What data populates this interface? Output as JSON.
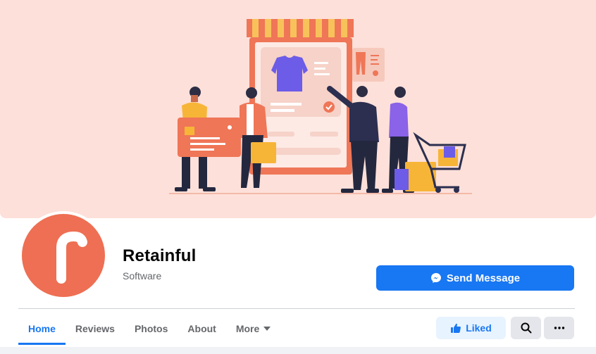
{
  "page": {
    "name": "Retainful",
    "category": "Software",
    "avatar_letter": "r"
  },
  "actions": {
    "send_message": "Send Message",
    "liked": "Liked"
  },
  "tabs": [
    {
      "label": "Home",
      "active": true
    },
    {
      "label": "Reviews",
      "active": false
    },
    {
      "label": "Photos",
      "active": false
    },
    {
      "label": "About",
      "active": false
    },
    {
      "label": "More",
      "active": false
    }
  ],
  "icons": {
    "messenger": "messenger-icon",
    "like": "thumbs-up-icon",
    "search": "search-icon",
    "more": "ellipsis-icon",
    "dropdown": "caret-down-icon"
  },
  "colors": {
    "accent": "#1877f2",
    "cover_bg": "#fde0d9",
    "brand": "#ee6f53"
  }
}
